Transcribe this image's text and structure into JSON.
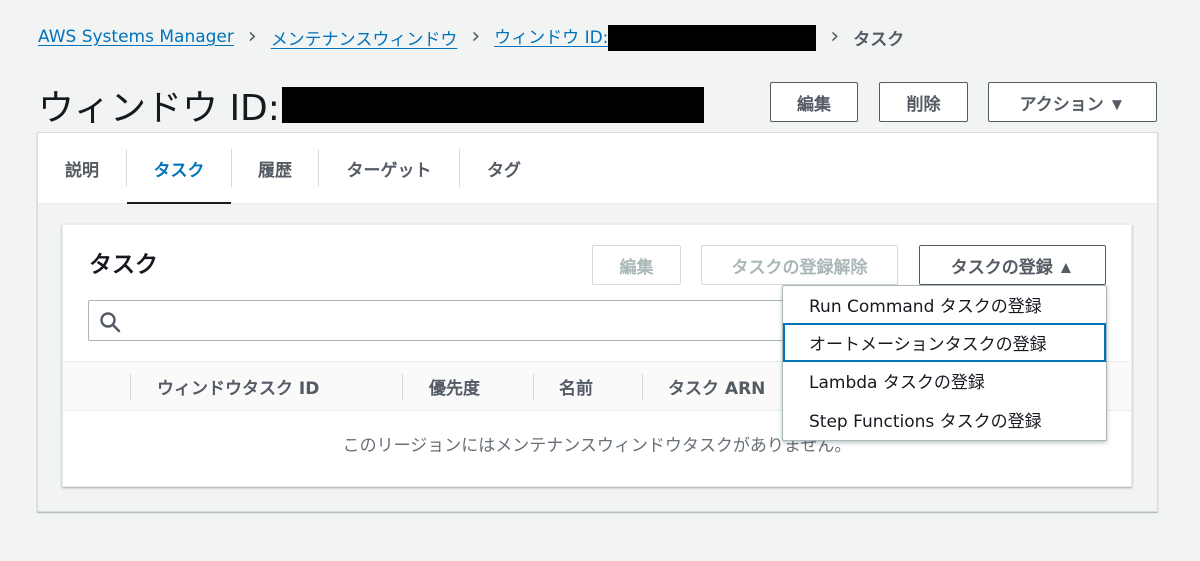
{
  "breadcrumb": {
    "items": [
      "AWS Systems Manager",
      "メンテナンスウィンドウ",
      "ウィンドウ ID:"
    ],
    "current": "タスク",
    "separator": "›"
  },
  "page": {
    "title_prefix": "ウィンドウ ID:",
    "buttons": {
      "edit": "編集",
      "delete": "削除",
      "actions": "アクション ▼"
    }
  },
  "tabs": [
    "説明",
    "タスク",
    "履歴",
    "ターゲット",
    "タグ"
  ],
  "active_tab": "タスク",
  "tasks_panel": {
    "title": "タスク",
    "buttons": {
      "edit": "編集",
      "deregister": "タスクの登録解除",
      "register": "タスクの登録 ▲"
    },
    "search": {
      "placeholder": "",
      "value": ""
    },
    "columns": [
      "ウィンドウタスク ID",
      "優先度",
      "名前",
      "タスク ARN"
    ],
    "empty_message": "このリージョンにはメンテナンスウィンドウタスクがありません。"
  },
  "register_menu": {
    "items": [
      "Run Command タスクの登録",
      "オートメーションタスクの登録",
      "Lambda タスクの登録",
      "Step Functions タスクの登録"
    ],
    "focused_index": 1
  },
  "colors": {
    "link": "#0073bb",
    "text": "#16191f",
    "muted": "#545b64",
    "disabled": "#aab7b8",
    "redaction": "#000000"
  },
  "icons": {
    "search": "search-icon",
    "separator": "chevron-right-icon"
  }
}
